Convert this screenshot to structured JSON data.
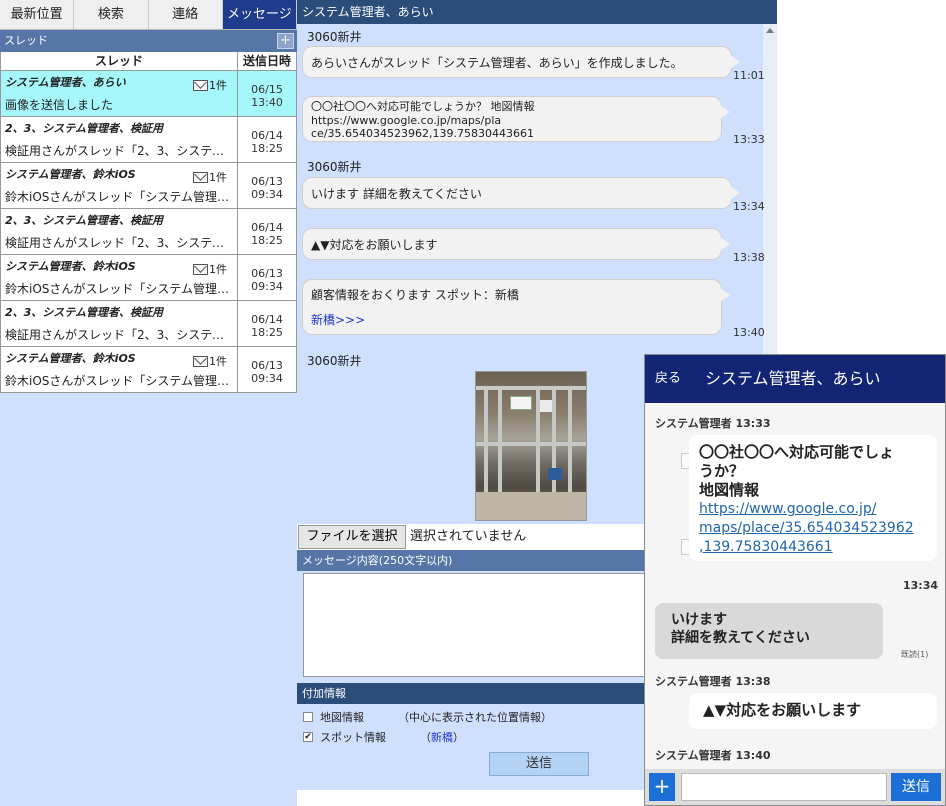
{
  "tabs": [
    {
      "label": "最新位置"
    },
    {
      "label": "検索"
    },
    {
      "label": "連絡"
    },
    {
      "label": "メッセージ"
    }
  ],
  "thread_panel": {
    "header": "スレッド",
    "add_label": "+",
    "col_thread": "スレッド",
    "col_date": "送信日時",
    "rows": [
      {
        "title": "システム管理者、あらい",
        "preview": "画像を送信しました",
        "mail": "1件",
        "date": "06/15",
        "time": "13:40"
      },
      {
        "title": "2、3、システム管理者、検証用",
        "preview": "検証用さんがスレッド「2、3、システム管理…",
        "mail": "",
        "date": "06/14",
        "time": "18:25"
      },
      {
        "title": "システム管理者、鈴木iOS",
        "preview": "鈴木iOSさんがスレッド「システム管理者、…",
        "mail": "1件",
        "date": "06/13",
        "time": "09:34"
      },
      {
        "title": "2、3、システム管理者、検証用",
        "preview": "検証用さんがスレッド「2、3、システム管理…",
        "mail": "",
        "date": "06/14",
        "time": "18:25"
      },
      {
        "title": "システム管理者、鈴木iOS",
        "preview": "鈴木iOSさんがスレッド「システム管理者、…",
        "mail": "1件",
        "date": "06/13",
        "time": "09:34"
      },
      {
        "title": "2、3、システム管理者、検証用",
        "preview": "検証用さんがスレッド「2、3、システム管理…",
        "mail": "",
        "date": "06/14",
        "time": "18:25"
      },
      {
        "title": "システム管理者、鈴木iOS",
        "preview": "鈴木iOSさんがスレッド「システム管理者、…",
        "mail": "1件",
        "date": "06/13",
        "time": "09:34"
      }
    ]
  },
  "chat": {
    "header": "システム管理者、あらい",
    "sender_a": "3060新井",
    "msg1": "あらいさんがスレッド「システム管理者、あらい」を作成しました。",
    "time1": "11:01",
    "msg2_line1": "〇〇社〇〇へ対応可能でしょうか？ 地図情報 https://www.google.co.jp/maps/pla",
    "msg2_line2": "ce/35.654034523962,139.75830443661",
    "time2": "13:33",
    "sender_b": "3060新井",
    "msg3": "いけます 詳細を教えてください",
    "time3": "13:34",
    "msg4": "▲▼対応をお願いします",
    "time4": "13:38",
    "msg5": "顧客情報をおくります スポット：新橋",
    "msg5_link": "新橋>>>",
    "time5": "13:40",
    "sender_c": "3060新井"
  },
  "composer": {
    "file_button": "ファイルを選択",
    "file_status": "選択されていません",
    "message_label": "メッセージ内容(250文字以内)",
    "extra_label": "付加情報",
    "opt_map_label": "地図情報",
    "opt_map_desc": "（中心に表示された位置情報）",
    "opt_map_checked": false,
    "opt_spot_label": "スポット情報",
    "opt_spot_desc_pre": "（",
    "opt_spot_link": "新橋",
    "opt_spot_desc_post": "）",
    "opt_spot_checked": true,
    "send": "送信"
  },
  "phone": {
    "back": "戻る",
    "title": "システム管理者、あらい",
    "sender1": "システム管理者 13:33",
    "bubble1_line1": "〇〇社〇〇へ対応可能でしょ",
    "bubble1_line2": "うか？",
    "bubble1_line3": "地図情報",
    "bubble1_link1": "https://www.google.co.jp/",
    "bubble1_link2": "maps/place/35.654034523962",
    "bubble1_link3": ",139.75830443661",
    "time1": "13:34",
    "bubble2_line1": "いけます",
    "bubble2_line2": "詳細を教えてください",
    "read": "既読(1)",
    "sender2": "システム管理者 13:38",
    "bubble3": "▲▼対応をお願いします",
    "sender3": "システム管理者 13:40",
    "plus": "+",
    "send": "送信"
  },
  "colors": {
    "tab_active": "#1f3c8c",
    "selected_row": "#a6f7fb",
    "panel_bg": "#cfe0ff",
    "phone_header": "#122474",
    "phone_accent": "#1c6fd6"
  }
}
